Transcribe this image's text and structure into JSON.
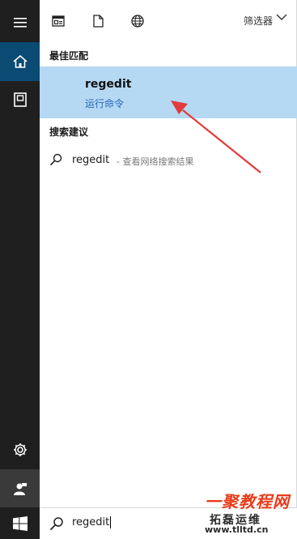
{
  "rail": {
    "icons": [
      "hamburger-menu-icon",
      "home-icon",
      "notebook-icon",
      "settings-icon",
      "user-feedback-icon"
    ]
  },
  "topbar": {
    "filter_label": "筛选器",
    "icons": [
      "document-view-icon",
      "file-icon",
      "globe-icon",
      "chevron-down-icon"
    ]
  },
  "best_match": {
    "section_title": "最佳匹配",
    "title": "regedit",
    "subtitle": "运行命令"
  },
  "suggestions": {
    "section_title": "搜索建议",
    "items": [
      {
        "term": "regedit",
        "description": "- 查看网络搜索结果"
      }
    ]
  },
  "taskbar": {
    "search_value": "regedit"
  },
  "watermark": {
    "line1": "一聚教程网",
    "line2": "拓磊运维",
    "line3": "www.tlltd.cn"
  },
  "colors": {
    "rail_bg": "#1f1f1f",
    "active_home": "#0a4a73",
    "highlight": "#b5d8f3",
    "accent_text": "#2566b8",
    "arrow": "#e23b3b"
  }
}
